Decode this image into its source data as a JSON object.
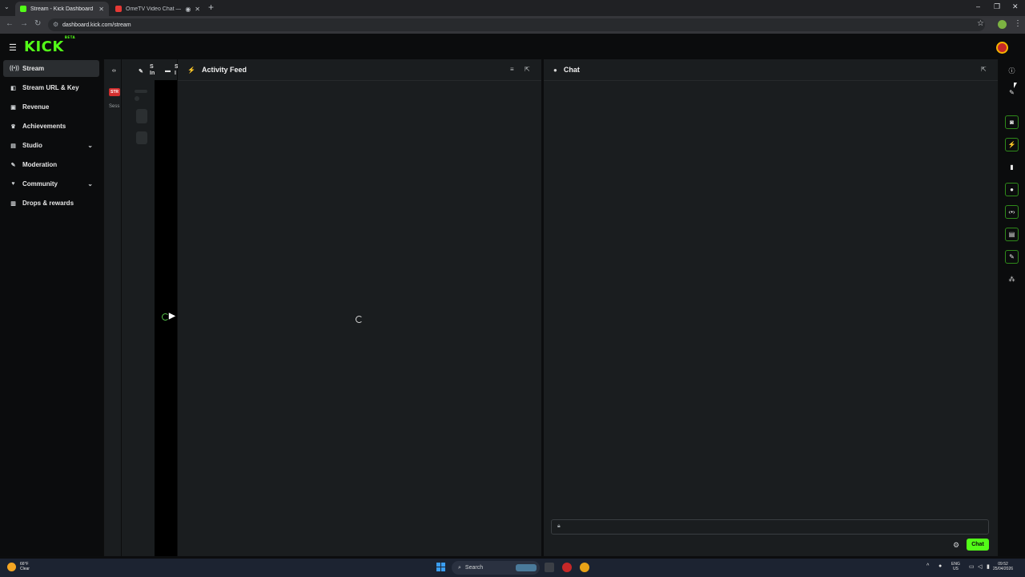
{
  "browser": {
    "tabs": [
      {
        "title": "Stream - Kick Dashboard",
        "active": true
      },
      {
        "title": "OmeTV Video Chat — Ome",
        "active": false
      }
    ],
    "url": "dashboard.kick.com/stream"
  },
  "header": {
    "logo": "KICK",
    "logo_mark": "BETA"
  },
  "sidebar": {
    "items": [
      {
        "label": "Stream",
        "icon": "broadcast-icon",
        "active": true
      },
      {
        "label": "Stream URL & Key",
        "icon": "key-icon"
      },
      {
        "label": "Revenue",
        "icon": "revenue-icon"
      },
      {
        "label": "Achievements",
        "icon": "trophy-icon"
      },
      {
        "label": "Studio",
        "icon": "studio-icon",
        "expandable": true
      },
      {
        "label": "Moderation",
        "icon": "wrench-icon"
      },
      {
        "label": "Community",
        "icon": "community-icon",
        "expandable": true
      },
      {
        "label": "Drops & rewards",
        "icon": "gift-icon"
      }
    ]
  },
  "side_strip": {
    "col_a": "S",
    "col_a2": "In",
    "col_b": "S",
    "col_b2": "I",
    "badge": "STR",
    "session": "Sess"
  },
  "activity_feed": {
    "title": "Activity Feed"
  },
  "chat": {
    "title": "Chat",
    "send_label": "Chat"
  },
  "taskbar": {
    "weather_temp": "66°F",
    "weather_desc": "Clear",
    "search_placeholder": "Search",
    "lang": "ENG",
    "region": "US",
    "time": "09:52",
    "date": "25/04/2026"
  },
  "colors": {
    "accent": "#53fc18",
    "panel_bg": "#1a1d1f",
    "app_bg": "#0b0c0d"
  }
}
